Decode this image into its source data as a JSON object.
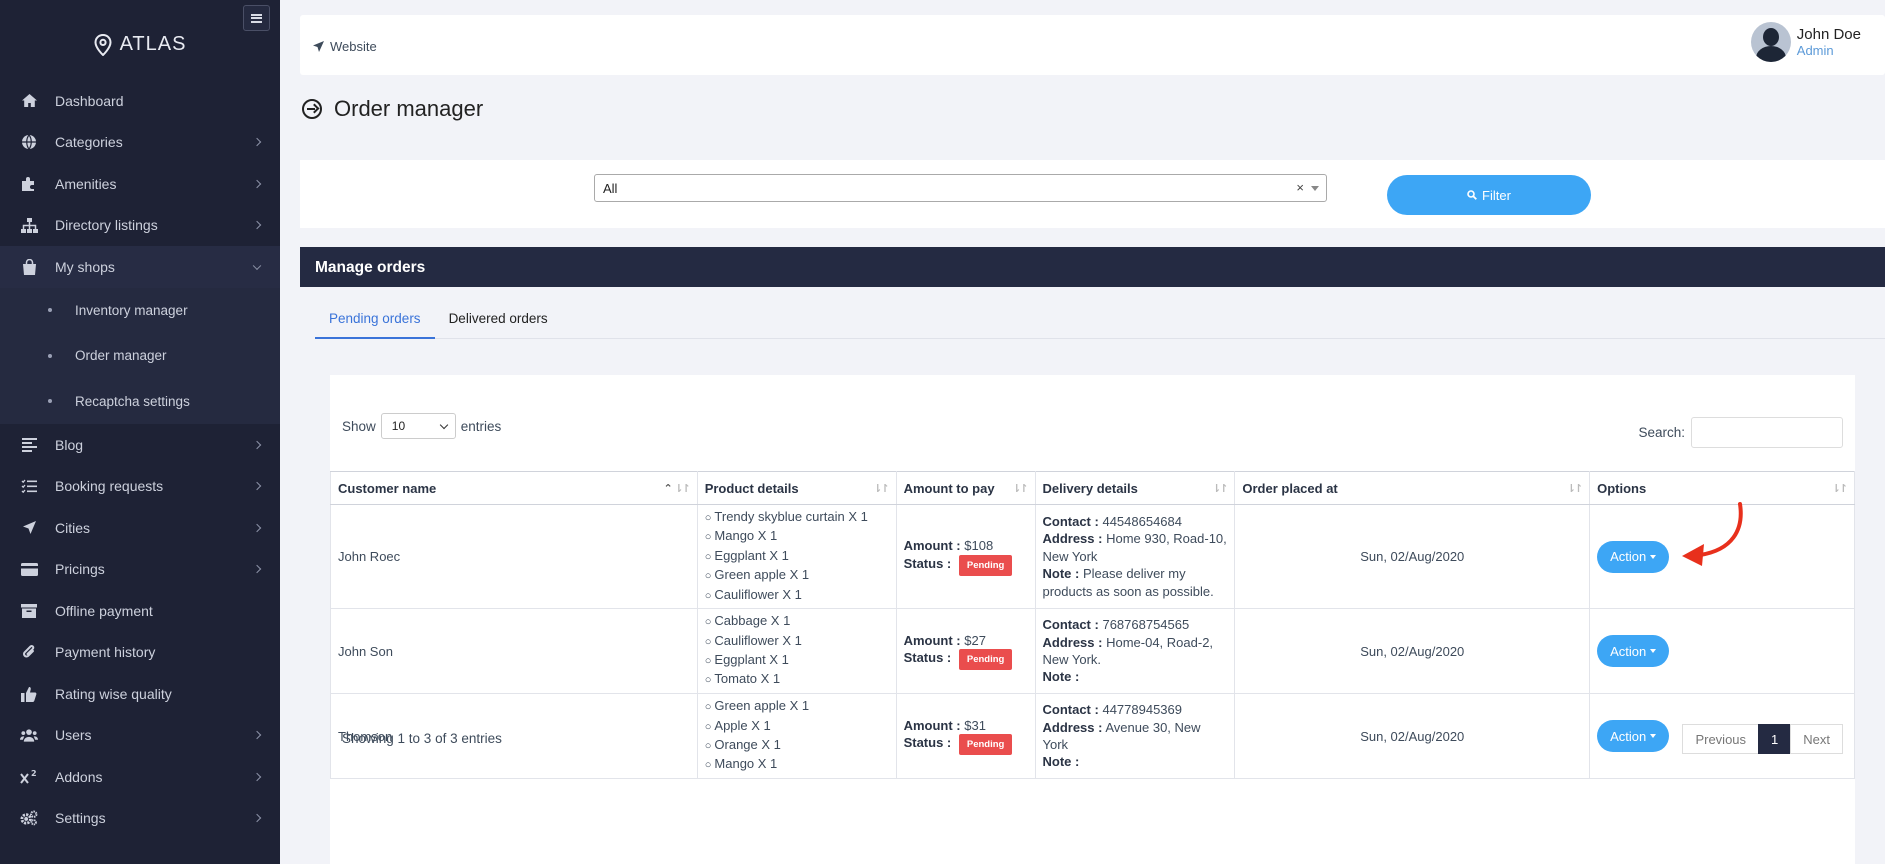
{
  "sidebar": {
    "brand": "ATLAS",
    "items": [
      {
        "label": "Dashboard",
        "icon": "home-icon"
      },
      {
        "label": "Categories",
        "icon": "globe-icon"
      },
      {
        "label": "Amenities",
        "icon": "puzzle-icon"
      },
      {
        "label": "Directory listings",
        "icon": "sitemap-icon"
      },
      {
        "label": "My shops",
        "icon": "shopping-bag-icon"
      },
      {
        "label": "Blog",
        "icon": "align-left-icon"
      },
      {
        "label": "Booking requests",
        "icon": "tasks-icon"
      },
      {
        "label": "Cities",
        "icon": "location-arrow-icon"
      },
      {
        "label": "Pricings",
        "icon": "credit-card-icon"
      },
      {
        "label": "Offline payment",
        "icon": "archive-icon"
      },
      {
        "label": "Payment history",
        "icon": "paperclip-icon"
      },
      {
        "label": "Rating wise quality",
        "icon": "thumbs-up-icon"
      },
      {
        "label": "Users",
        "icon": "users-icon"
      },
      {
        "label": "Addons",
        "icon": "superscript-icon"
      },
      {
        "label": "Settings",
        "icon": "cogs-icon"
      }
    ],
    "submenu": [
      "Inventory manager",
      "Order manager",
      "Recaptcha settings"
    ]
  },
  "topbar": {
    "website_label": "Website",
    "user_name": "John Doe",
    "user_role": "Admin"
  },
  "page": {
    "title": "Order manager"
  },
  "filter": {
    "selected": "All",
    "clear": "×",
    "button_label": "Filter"
  },
  "orders": {
    "header": "Manage orders",
    "tabs": [
      "Pending orders",
      "Delivered orders"
    ],
    "show_label": "Show",
    "entries_label": "entries",
    "page_length": "10",
    "search_label": "Search:",
    "columns": [
      "Customer name",
      "Product details",
      "Amount to pay",
      "Delivery details",
      "Order placed at",
      "Options"
    ],
    "labels": {
      "amount": "Amount :",
      "status": "Status :",
      "contact": "Contact :",
      "address": "Address :",
      "note": "Note :",
      "action": "Action"
    },
    "rows": [
      {
        "customer": "John Roec",
        "products": [
          "Trendy skyblue curtain X 1",
          "Mango X 1",
          "Eggplant X 1",
          "Green apple X 1",
          "Cauliflower X 1"
        ],
        "amount": "$108",
        "status": "Pending",
        "contact": "44548654684",
        "address": "Home 930, Road-10, New York",
        "note": "Please deliver my products as soon as possible.",
        "date": "Sun, 02/Aug/2020"
      },
      {
        "customer": "John Son",
        "products": [
          "Cabbage X 1",
          "Cauliflower X 1",
          "Eggplant X 1",
          "Tomato X 1"
        ],
        "amount": "$27",
        "status": "Pending",
        "contact": "768768754565",
        "address": "Home-04, Road-2, New York.",
        "note": "",
        "date": "Sun, 02/Aug/2020"
      },
      {
        "customer": "Thomson",
        "products": [
          "Green apple X 1",
          "Apple X 1",
          "Orange X 1",
          "Mango X 1"
        ],
        "amount": "$31",
        "status": "Pending",
        "contact": "44778945369",
        "address": "Avenue 30, New York",
        "note": "",
        "date": "Sun, 02/Aug/2020"
      }
    ],
    "info": "Showing 1 to 3 of 3 entries",
    "pagination": {
      "previous": "Previous",
      "current": "1",
      "next": "Next"
    }
  },
  "colors": {
    "sidebar": "#1e2235",
    "accent": "#3da6f5",
    "danger": "#ea4d4d",
    "arrow": "#e8301c"
  }
}
